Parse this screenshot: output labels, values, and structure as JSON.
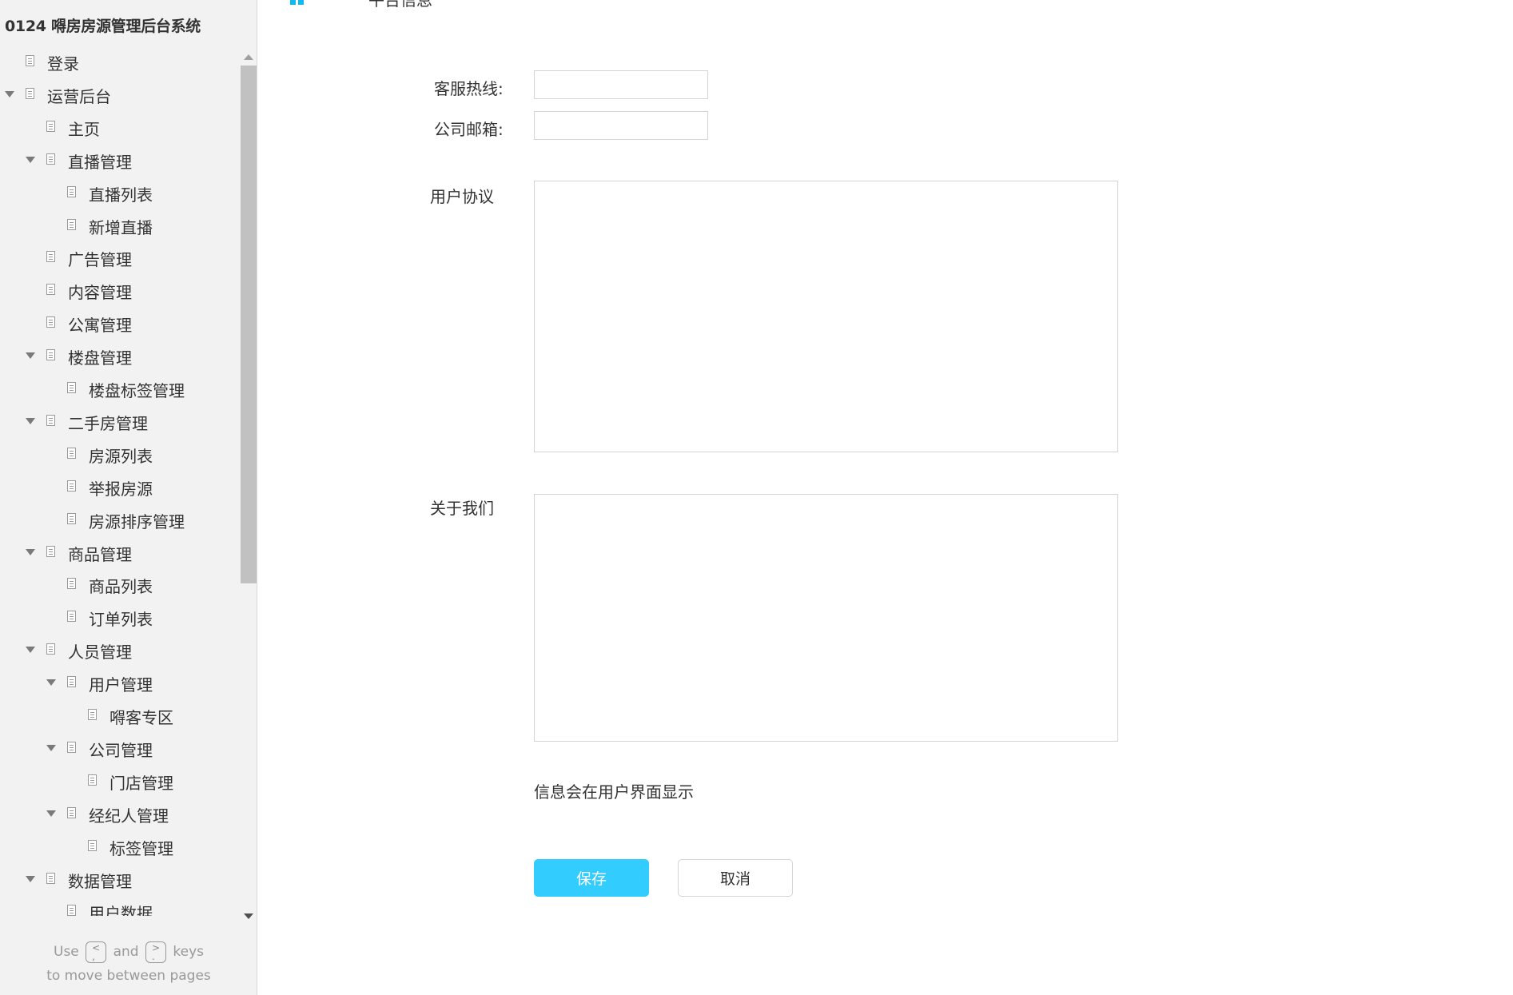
{
  "app": {
    "title": "0124 嘚房房源管理后台系统"
  },
  "sidebar": {
    "items": [
      {
        "label": "登录",
        "level": 0,
        "expandable": false
      },
      {
        "label": "运营后台",
        "level": 0,
        "expandable": true
      },
      {
        "label": "主页",
        "level": 1,
        "expandable": false
      },
      {
        "label": "直播管理",
        "level": 1,
        "expandable": true
      },
      {
        "label": "直播列表",
        "level": 2,
        "expandable": false
      },
      {
        "label": "新增直播",
        "level": 2,
        "expandable": false
      },
      {
        "label": "广告管理",
        "level": 1,
        "expandable": false
      },
      {
        "label": "内容管理",
        "level": 1,
        "expandable": false
      },
      {
        "label": "公寓管理",
        "level": 1,
        "expandable": false
      },
      {
        "label": "楼盘管理",
        "level": 1,
        "expandable": true
      },
      {
        "label": "楼盘标签管理",
        "level": 2,
        "expandable": false
      },
      {
        "label": "二手房管理",
        "level": 1,
        "expandable": true
      },
      {
        "label": "房源列表",
        "level": 2,
        "expandable": false
      },
      {
        "label": "举报房源",
        "level": 2,
        "expandable": false
      },
      {
        "label": "房源排序管理",
        "level": 2,
        "expandable": false
      },
      {
        "label": "商品管理",
        "level": 1,
        "expandable": true
      },
      {
        "label": "商品列表",
        "level": 2,
        "expandable": false
      },
      {
        "label": "订单列表",
        "level": 2,
        "expandable": false
      },
      {
        "label": "人员管理",
        "level": 1,
        "expandable": true
      },
      {
        "label": "用户管理",
        "level": 2,
        "expandable": true
      },
      {
        "label": "嘚客专区",
        "level": 3,
        "expandable": false
      },
      {
        "label": "公司管理",
        "level": 2,
        "expandable": true
      },
      {
        "label": "门店管理",
        "level": 3,
        "expandable": false
      },
      {
        "label": "经纪人管理",
        "level": 2,
        "expandable": true
      },
      {
        "label": "标签管理",
        "level": 3,
        "expandable": false
      },
      {
        "label": "数据管理",
        "level": 1,
        "expandable": true
      },
      {
        "label": "用户数据",
        "level": 2,
        "expandable": false
      }
    ],
    "footer": {
      "use": "Use",
      "prev_key_top": "<",
      "prev_key_bottom": ",",
      "and": "and",
      "next_key_top": ">",
      "next_key_bottom": ".",
      "keys": "keys",
      "line2": "to move between pages"
    }
  },
  "main": {
    "page_title": "平台信息",
    "accent_color": "#33ccff",
    "form": {
      "hotline_label": "客服热线:",
      "hotline_value": "",
      "email_label": "公司邮箱:",
      "email_value": "",
      "agreement_label": "用户协议",
      "agreement_value": "",
      "about_label": "关于我们",
      "about_value": "",
      "hint": "信息会在用户界面显示"
    },
    "buttons": {
      "save": "保存",
      "cancel": "取消"
    }
  }
}
